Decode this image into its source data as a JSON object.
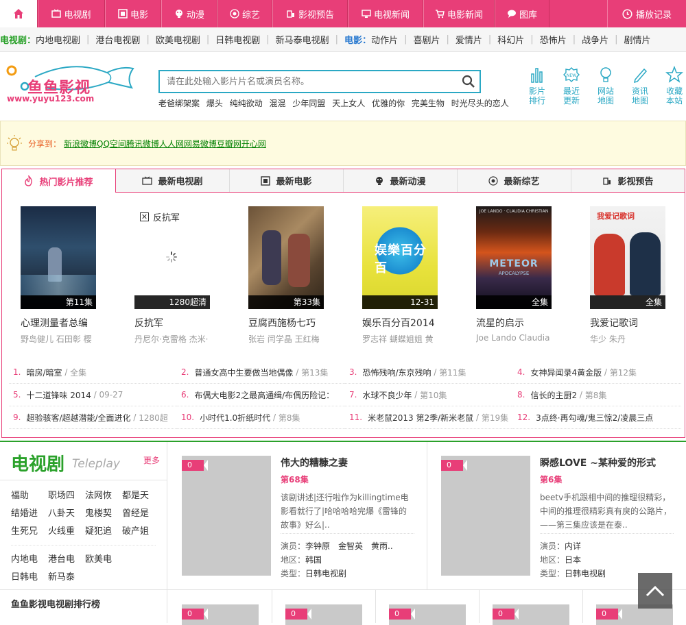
{
  "nav": {
    "items": [
      {
        "label": "电视剧",
        "icon": "tv-icon"
      },
      {
        "label": "电影",
        "icon": "film-icon"
      },
      {
        "label": "动漫",
        "icon": "anime-icon"
      },
      {
        "label": "综艺",
        "icon": "variety-icon"
      },
      {
        "label": "影视预告",
        "icon": "trailer-icon"
      },
      {
        "label": "电视新闻",
        "icon": "monitor-icon"
      },
      {
        "label": "电影新闻",
        "icon": "cart-icon"
      },
      {
        "label": "图库",
        "icon": "chat-icon"
      }
    ],
    "record": "播放记录"
  },
  "subnav": {
    "tv_label": "电视剧：",
    "tv": [
      "内地电视剧",
      "港台电视剧",
      "欧美电视剧",
      "日韩电视剧",
      "新马泰电视剧"
    ],
    "film_label": "电影：",
    "film": [
      "动作片",
      "喜剧片",
      "爱情片",
      "科幻片",
      "恐怖片",
      "战争片",
      "剧情片"
    ]
  },
  "header": {
    "logo_text": "鱼鱼影视",
    "logo_url": "www.yuyu123.com",
    "search_placeholder": "请在此处输入影片片名或演员名称。",
    "hotwords": [
      "老爸绑架案",
      "爆头",
      "纯纯欲动",
      "混混",
      "少年同盟",
      "天上女人",
      "优雅的你",
      "完美生物",
      "时光尽头的恋人"
    ],
    "quick": [
      {
        "l1": "影片",
        "l2": "排行"
      },
      {
        "l1": "最近",
        "l2": "更新"
      },
      {
        "l1": "网站",
        "l2": "地图"
      },
      {
        "l1": "资讯",
        "l2": "地图"
      },
      {
        "l1": "收藏",
        "l2": "本站"
      }
    ]
  },
  "share": {
    "label": "分享到：",
    "links": "新浪微博QQ空间腾讯微博人人网网易微博豆瓣网开心网"
  },
  "tabs": [
    "热门影片推荐",
    "最新电视剧",
    "最新电影",
    "最新动漫",
    "最新综艺",
    "影视预告"
  ],
  "movies": [
    {
      "title": "心理测量者总编",
      "actors": "野岛健儿 石田彰 樱",
      "ep": "第11集"
    },
    {
      "title": "反抗军",
      "actors": "丹尼尔·克雷格 杰米·",
      "ep": "1280超清",
      "alt": "反抗军"
    },
    {
      "title": "豆腐西施杨七巧",
      "actors": "张岩 闫学晶 王红梅",
      "ep": "第33集"
    },
    {
      "title": "娱乐百分百2014",
      "actors": "罗志祥 蝴蝶姐姐 黄",
      "ep": "12-31"
    },
    {
      "title": "流星的启示",
      "actors": "Joe Lando Claudia",
      "ep": "全集"
    },
    {
      "title": "我爱记歌词",
      "actors": "华少 朱丹",
      "ep": "全集"
    }
  ],
  "ranks": [
    {
      "n": "1.",
      "t": "暗房/暗室",
      "e": "全集"
    },
    {
      "n": "2.",
      "t": "普通女高中生要做当地偶像",
      "e": "第13集"
    },
    {
      "n": "3.",
      "t": "恐怖残响/东京残响",
      "e": "第11集"
    },
    {
      "n": "4.",
      "t": "女神异闻录4黄金版",
      "e": "第12集"
    },
    {
      "n": "5.",
      "t": "十二道锋味 2014",
      "e": "09-27"
    },
    {
      "n": "6.",
      "t": "布偶大电影2之最高通缉/布偶历险记：",
      "e": ""
    },
    {
      "n": "7.",
      "t": "水球不良少年",
      "e": "第10集"
    },
    {
      "n": "8.",
      "t": "信长的主厨2",
      "e": "第8集"
    },
    {
      "n": "9.",
      "t": "超验骇客/超越潜能/全面进化",
      "e": "1280超"
    },
    {
      "n": "10.",
      "t": "小时代1.0折纸时代",
      "e": "第8集"
    },
    {
      "n": "11.",
      "t": "米老鼠2013 第2季/新米老鼠",
      "e": "第19集"
    },
    {
      "n": "12.",
      "t": "3点终·再勾魂/鬼三惊2/凌晨三点",
      "e": ""
    }
  ],
  "tv": {
    "title": "电视剧",
    "en": "Teleplay",
    "more": "更多",
    "genres": [
      "福助",
      "职场四",
      "法网恢",
      "都是天",
      "结婚进",
      "八卦天",
      "鬼楼契",
      "曾经是",
      "生死兄",
      "火线重",
      "疑犯追",
      "破产姐"
    ],
    "regions": [
      "内地电",
      "港台电",
      "欧美电",
      "日韩电",
      "新马泰"
    ],
    "rank_title": "鱼鱼影视电视剧排行榜",
    "shows": [
      {
        "name": "伟大的糟糠之妻",
        "ep": "第68集",
        "desc": "该剧讲述|还行啦作为killingtime电影看就行了|哈哈哈哈完爆《雷锋的故事》好么|..",
        "actors_label": "演员：",
        "actors": "李钟原　金智英　黄雨..",
        "region_label": "地区：",
        "region": "韩国",
        "type_label": "类型：",
        "type": "日韩电视剧",
        "badge": "0"
      },
      {
        "name": "瞬感LOVE ~某种爱的形式",
        "ep": "第6集",
        "desc": "beetv手机跟相中间的推理很精彩，中间的推理很精彩真有戾的公路片，——第三集应该是在泰..",
        "actors_label": "演员：",
        "actors": "内详",
        "region_label": "地区：",
        "region": "日本",
        "type_label": "类型：",
        "type": "日韩电视剧",
        "badge": "0"
      }
    ],
    "mini_badges": [
      "0",
      "0",
      "0",
      "0",
      "0"
    ]
  }
}
